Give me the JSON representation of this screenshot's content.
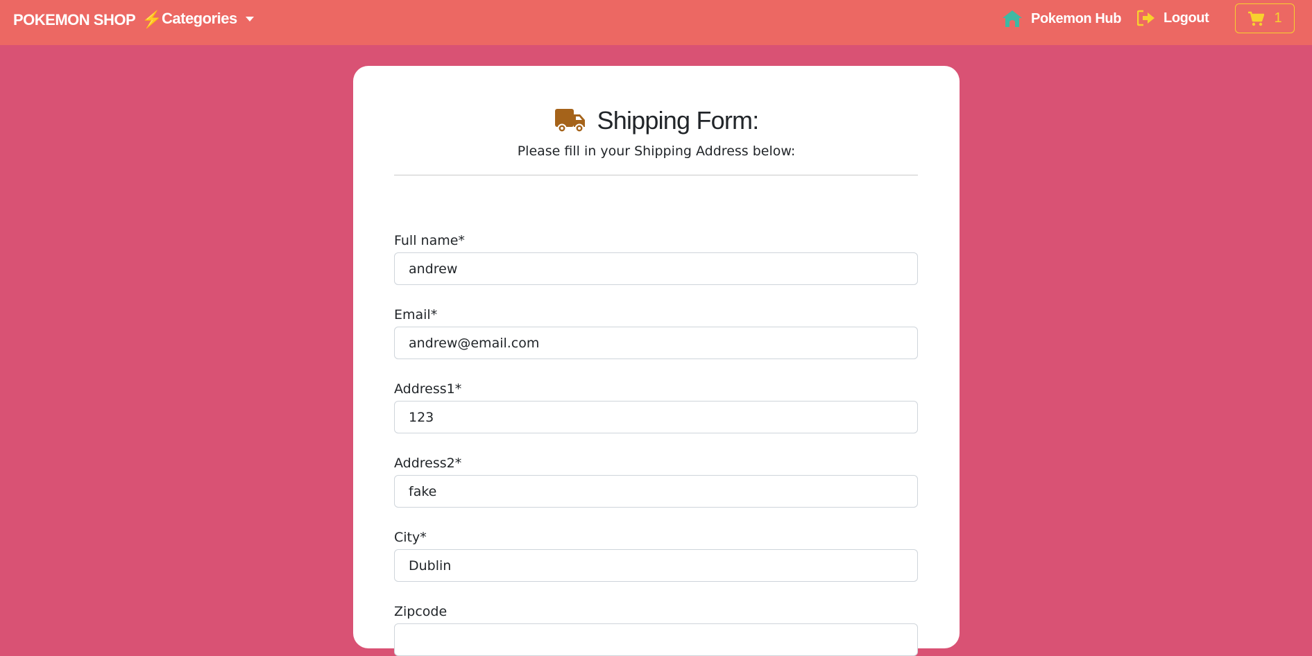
{
  "navbar": {
    "brand": "POKEMON SHOP",
    "brand_icon": "lightning-bolt-icon",
    "categories_label": "Categories",
    "hub_label": "Pokemon Hub",
    "hub_icon": "home-icon",
    "logout_label": "Logout",
    "logout_icon": "sign-out-icon",
    "cart_count": "1",
    "cart_icon": "shopping-cart-icon"
  },
  "form": {
    "icon": "truck-icon",
    "title": "Shipping Form:",
    "subtitle": "Please fill in your Shipping Address below:",
    "fields": [
      {
        "label": "Full name*",
        "value": "andrew"
      },
      {
        "label": "Email*",
        "value": "andrew@email.com"
      },
      {
        "label": "Address1*",
        "value": "123"
      },
      {
        "label": "Address2*",
        "value": "fake"
      },
      {
        "label": "City*",
        "value": "Dublin"
      },
      {
        "label": "Zipcode",
        "value": ""
      }
    ]
  },
  "colors": {
    "page_bg": "#d95274",
    "navbar_bg": "#ec6863",
    "accent_yellow": "#f8d12e",
    "hub_icon_teal": "#3fb8a3",
    "truck_brown": "#a5631a"
  }
}
